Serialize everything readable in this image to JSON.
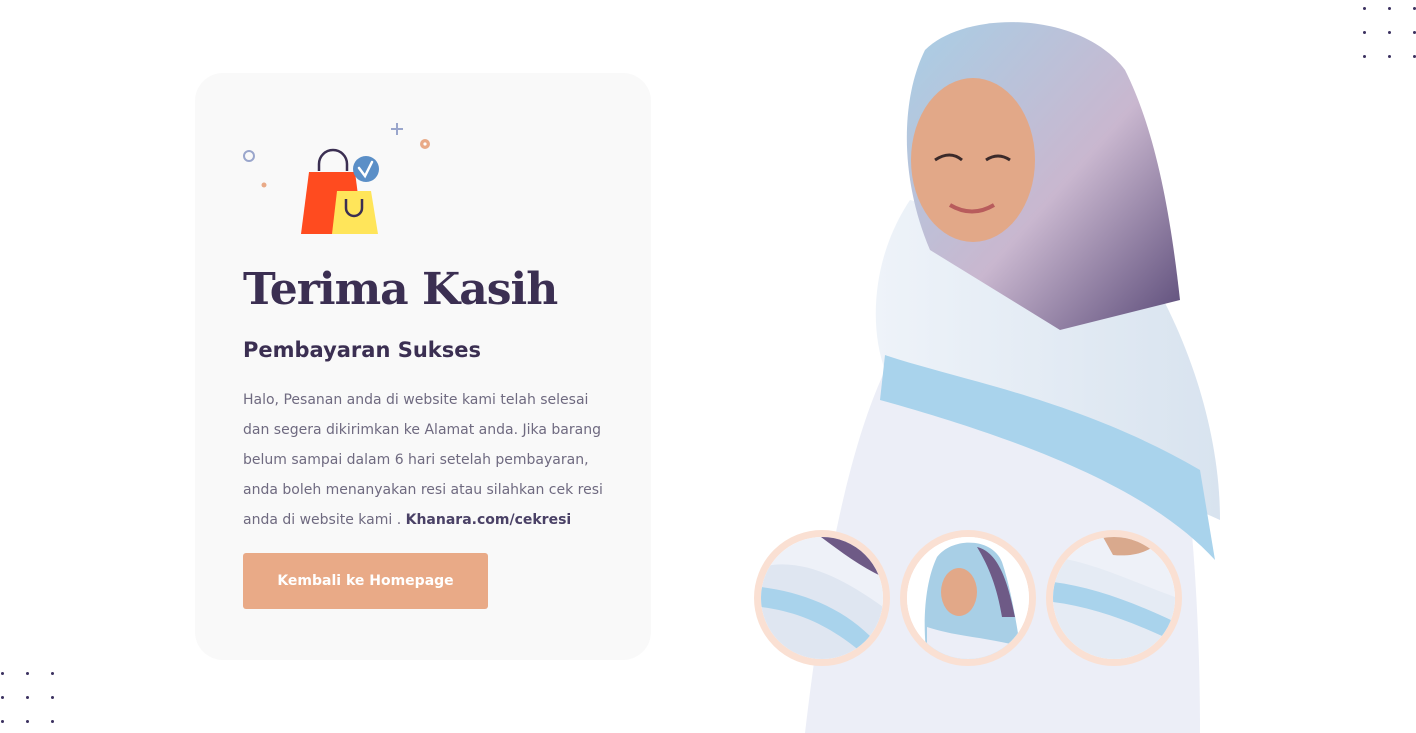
{
  "page": {
    "title": "Terima Kasih",
    "subtitle": "Pembayaran Sukses",
    "message_text": "Halo, Pesanan anda di website kami telah selesai dan segera dikirimkan ke Alamat anda. Jika barang belum sampai dalam 6 hari setelah pembayaran, anda boleh menanyakan resi atau silahkan cek resi anda di website kami .",
    "message_link": "Khanara.com/cekresi",
    "button_label": "Kembali ke Homepage"
  },
  "illustration": {
    "icon": "shopping-bags-check-icon",
    "colors": {
      "bag_back": "#ff4b1f",
      "bag_front": "#ffe55a",
      "check_badge": "#5b8fc7"
    }
  },
  "hero": {
    "image": "woman-in-hijab-photo",
    "thumbnails": [
      "hijab-detail-thumb",
      "hijab-portrait-thumb",
      "hijab-detail-thumb"
    ]
  },
  "colors": {
    "heading": "#3b2f52",
    "body_text": "#6f6a80",
    "card_bg": "#f9f9f9",
    "button_bg": "#e9aa87",
    "thumb_ring": "#fae0d3"
  }
}
